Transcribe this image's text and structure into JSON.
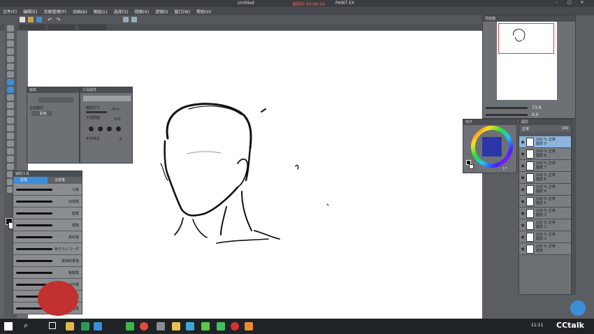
{
  "window": {
    "title": "Untitled",
    "recording": "录制中 00:06:34",
    "app_label": "PAINT EX"
  },
  "menu": [
    "文件(F)",
    "编辑(E)",
    "页面管理(P)",
    "动画(A)",
    "图层(L)",
    "选择(S)",
    "视图(V)",
    "滤镜(I)",
    "窗口(W)",
    "帮助(H)"
  ],
  "navigator": {
    "title": "导航器",
    "zoom": "73.9",
    "angle": "0.0"
  },
  "sub_tool_detail": {
    "title": "工具属性",
    "brush_size_label": "笔刷尺寸",
    "brush_size": "74.4",
    "opacity_label": "不透明度",
    "opacity": "100",
    "stabilizer_label": "手抖修正",
    "stabilizer": "6"
  },
  "tool_property": {
    "title": "画笔",
    "blend_label": "合成模式",
    "color_label": "彩色"
  },
  "color_wheel": {
    "title": "色环",
    "value": "17"
  },
  "sub_tool": {
    "title": "辅助工具",
    "tabs": [
      "铅笔",
      "马克笔"
    ],
    "brushes": [
      "G笔",
      "勾线笔",
      "圆笔",
      "晕笔",
      "真实笔",
      "丙ろうレコーダ",
      "玻璃效果笔",
      "粗糙笔",
      "S字笔",
      "旧版笔",
      "描线笔"
    ]
  },
  "layers": {
    "title": "图层",
    "blend": "正常",
    "opacity": "100",
    "items": [
      {
        "pct": "100 %",
        "mode": "正常",
        "name": "图层 9"
      },
      {
        "pct": "100 %",
        "mode": "正常",
        "name": "图层 8"
      },
      {
        "pct": "100 %",
        "mode": "正常",
        "name": "图层 7"
      },
      {
        "pct": "100 %",
        "mode": "正常",
        "name": "图层 6"
      },
      {
        "pct": "100 %",
        "mode": "正常",
        "name": "图层 4"
      },
      {
        "pct": "100 %",
        "mode": "正常",
        "name": "图层 5"
      },
      {
        "pct": "100 %",
        "mode": "正常",
        "name": "图层 3"
      },
      {
        "pct": "100 %",
        "mode": "正常",
        "name": "图层 2"
      },
      {
        "pct": "100 %",
        "mode": "正常",
        "name": "图层 1"
      },
      {
        "pct": "100 %",
        "mode": "正常",
        "name": "纸张"
      }
    ]
  },
  "taskbar": {
    "time": "11:11",
    "search_icon": "search-icon"
  },
  "watermark": "CCtalk",
  "colors": {
    "accent": "#3c8ed8",
    "panel": "#6d7175",
    "canvas": "#ffffff"
  }
}
